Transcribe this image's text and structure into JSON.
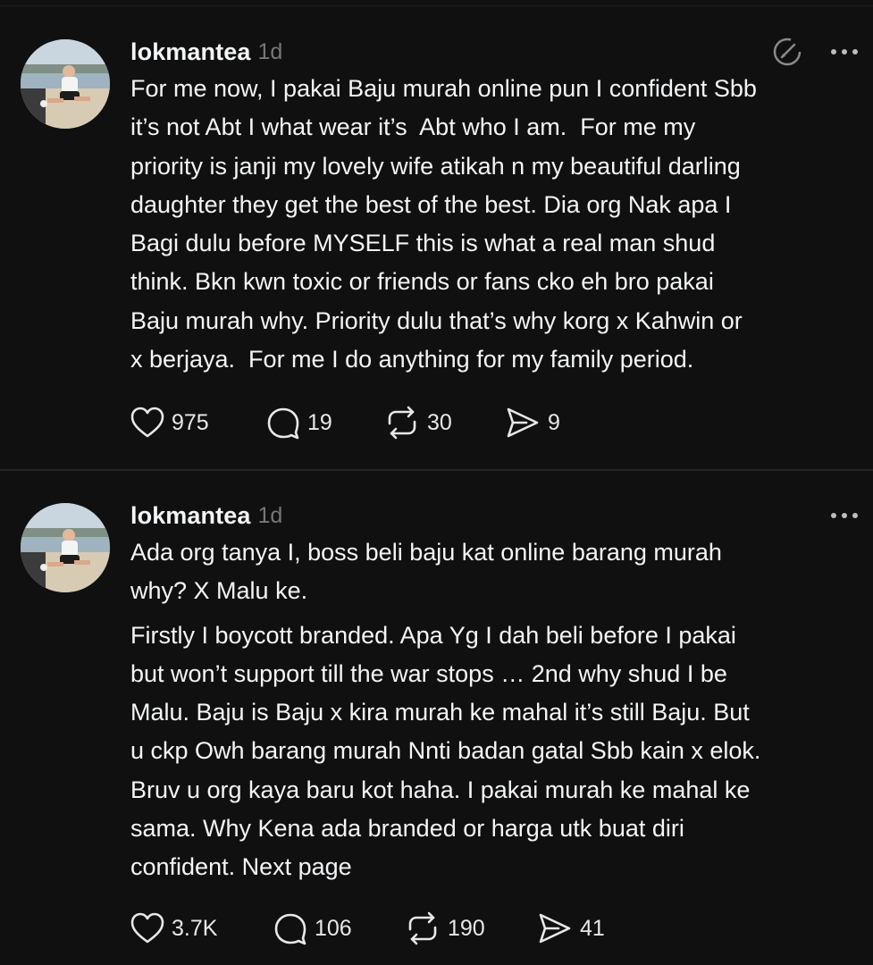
{
  "posts": [
    {
      "username": "lokmantea",
      "time": "1d",
      "show_verify_icon": true,
      "paragraphs": [
        "For me now, I pakai Baju murah online pun I confident Sbb\nit’s not Abt I what wear it’s  Abt who I am.  For me my\npriority is janji my lovely wife atikah n my beautiful darling\ndaughter they get the best of the best. Dia org Nak apa I\nBagi dulu before MYSELF this is what a real man shud\nthink. Bkn kwn toxic or friends or fans cko eh bro pakai\nBaju murah why. Priority dulu that’s why korg x Kahwin or\nx berjaya.  For me I do anything for my family period."
      ],
      "stats": {
        "likes": "975",
        "replies": "19",
        "reposts": "30",
        "shares": "9"
      }
    },
    {
      "username": "lokmantea",
      "time": "1d",
      "show_verify_icon": false,
      "paragraphs": [
        "Ada org tanya I, boss beli baju kat online barang murah\nwhy? X Malu ke.",
        "Firstly I boycott branded. Apa Yg I dah beli before I pakai\nbut won’t support till the war stops … 2nd why shud I be\nMalu. Baju is Baju x kira murah ke mahal it’s still Baju. But\nu ckp Owh barang murah Nnti badan gatal Sbb kain x elok.\nBruv u org kaya baru kot haha. I pakai murah ke mahal ke\nsama. Why Kena ada branded or harga utk buat diri\nconfident. Next page"
      ],
      "stats": {
        "likes": "3.7K",
        "replies": "106",
        "reposts": "190",
        "shares": "41"
      }
    }
  ],
  "icons": {
    "like": "heart-icon",
    "reply": "comment-bubble-icon",
    "repost": "repost-arrows-icon",
    "share": "send-arrow-icon",
    "more": "more-dots-icon",
    "verify": "edit-circle-icon"
  },
  "colors": {
    "background": "#101010",
    "text": "#f3f5f7",
    "muted": "#777777",
    "divider": "#262626"
  }
}
